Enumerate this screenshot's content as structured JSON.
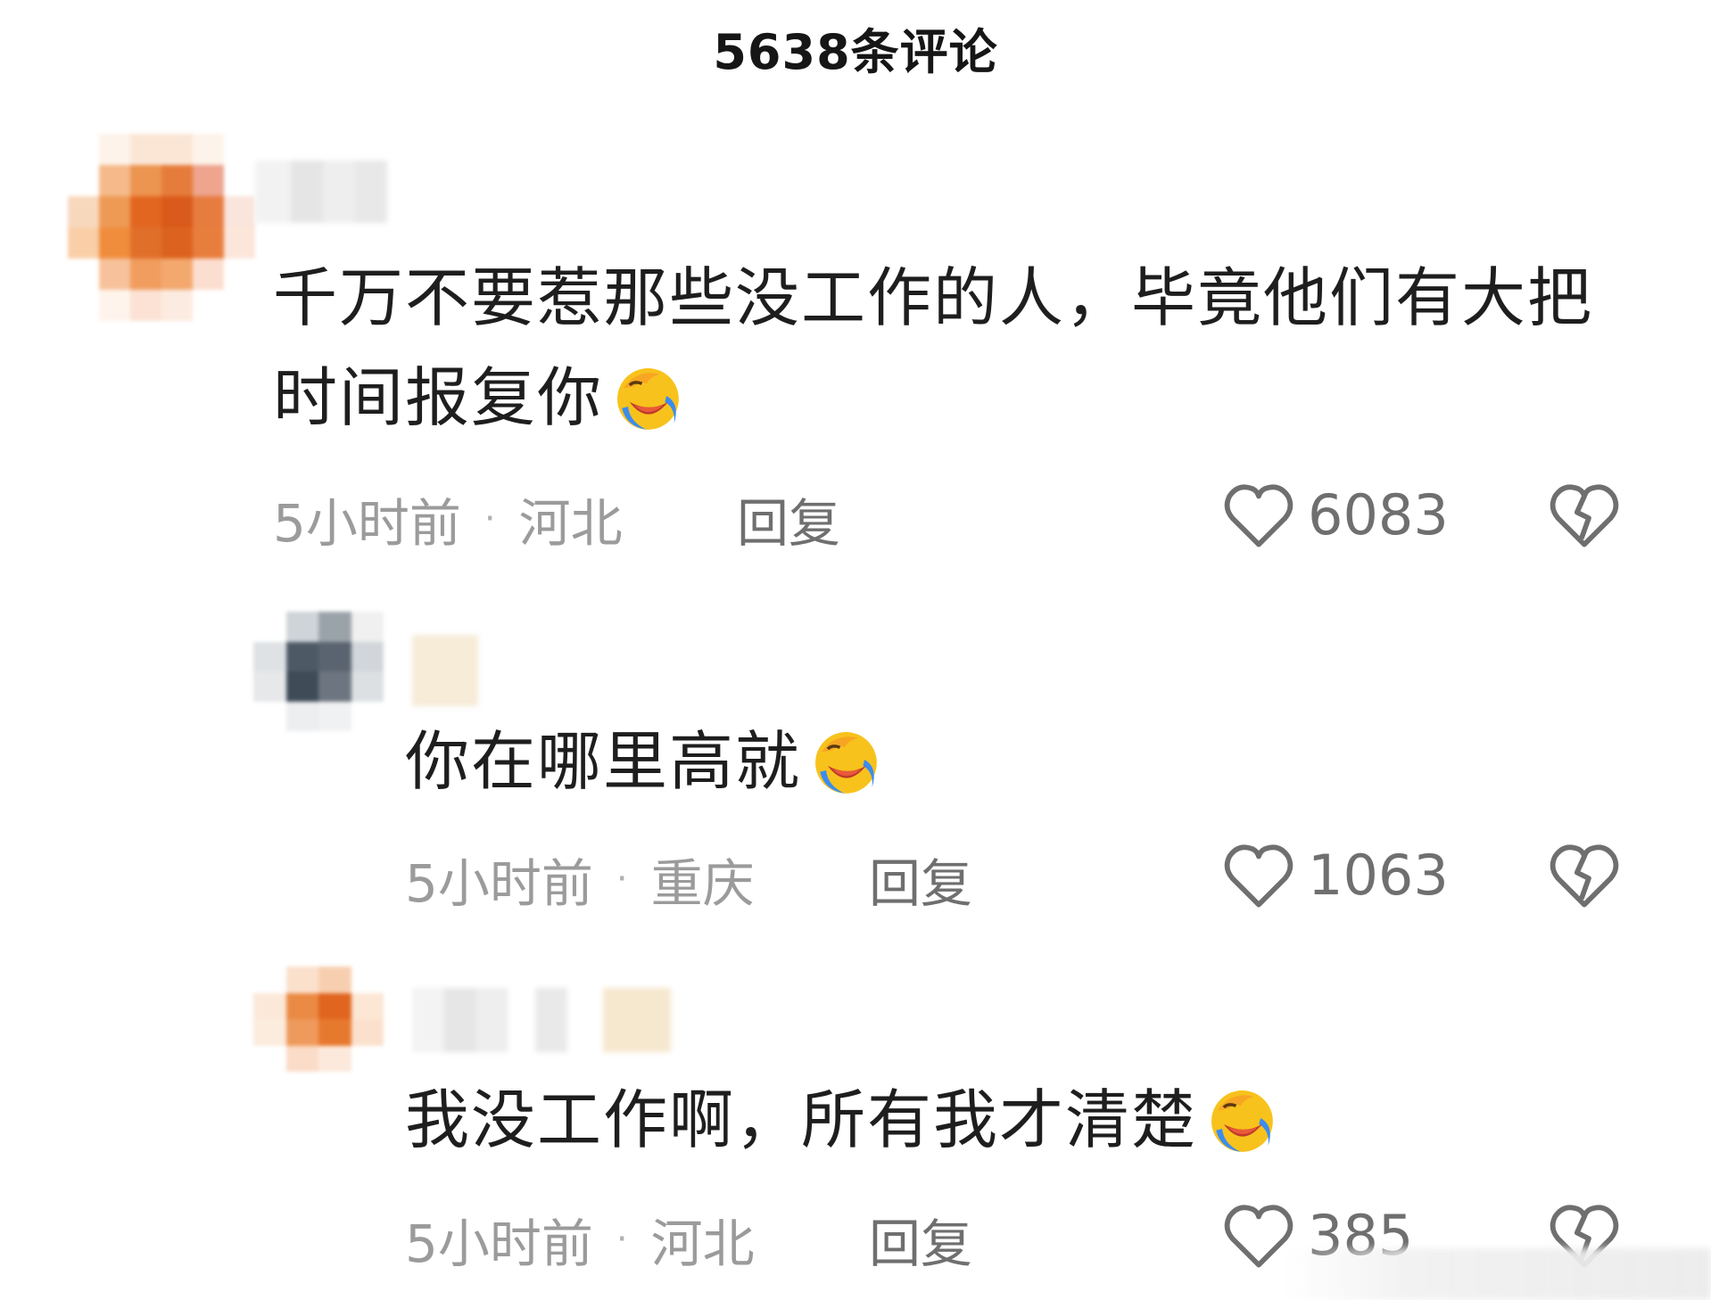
{
  "header": {
    "title": "5638条评论"
  },
  "comments": [
    {
      "text": "千万不要惹那些没工作的人，毕竟他们有大把时间报复你",
      "text_line1": "千万不要惹那些没工作的人，毕竟他们有大把",
      "text_line2": "时间报复你",
      "time": "5小时前",
      "location": "河北",
      "reply_label": "回复",
      "likes": "6083",
      "emoji": "facepalm-laughing-crying"
    },
    {
      "text": "你在哪里高就",
      "time": "5小时前",
      "location": "重庆",
      "reply_label": "回复",
      "likes": "1063",
      "emoji": "facepalm-laughing-crying"
    },
    {
      "text": "我没工作啊，所有我才清楚",
      "time": "5小时前",
      "location": "河北",
      "reply_label": "回复",
      "likes": "385",
      "emoji": "facepalm-laughing-crying"
    }
  ],
  "icons": {
    "like": "heart-outline-icon",
    "dislike": "broken-heart-icon"
  },
  "colors": {
    "background": "#ffffff",
    "text_primary": "#1e1e1e",
    "text_meta": "#9b9b9b",
    "text_action": "#6f6f6f",
    "avatar_orange": "#e8742c"
  }
}
